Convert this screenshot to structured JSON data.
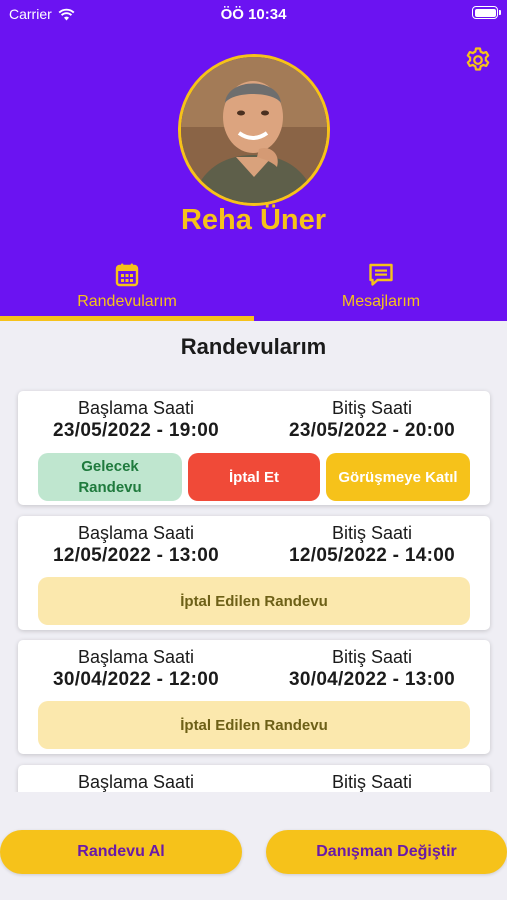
{
  "status_bar": {
    "carrier": "Carrier",
    "time": "ÖÖ 10:34"
  },
  "profile": {
    "name": "Reha Üner"
  },
  "tabs": [
    {
      "label": "Randevularım",
      "icon": "calendar-icon",
      "active": true
    },
    {
      "label": "Mesajlarım",
      "icon": "message-icon",
      "active": false
    }
  ],
  "section_title": "Randevularım",
  "appointments": [
    {
      "start_label": "Başlama Saati",
      "start": "23/05/2022 - 19:00",
      "end_label": "Bitiş Saati",
      "end": "23/05/2022 - 20:00",
      "status": "Gelecek Randevu",
      "cancel_label": "İptal Et",
      "join_label": "Görüşmeye Katıl"
    },
    {
      "start_label": "Başlama Saati",
      "start": "12/05/2022 - 13:00",
      "end_label": "Bitiş Saati",
      "end": "12/05/2022 - 14:00",
      "status": "İptal Edilen Randevu"
    },
    {
      "start_label": "Başlama Saati",
      "start": "30/04/2022 - 12:00",
      "end_label": "Bitiş Saati",
      "end": "30/04/2022 - 13:00",
      "status": "İptal Edilen Randevu"
    },
    {
      "start_label": "Başlama Saati",
      "end_label": "Bitiş Saati"
    }
  ],
  "actions": {
    "book": "Randevu Al",
    "change_consultant": "Danışman Değiştir"
  },
  "colors": {
    "header": "#6b13f2",
    "accent": "#f6c21a",
    "cancel": "#f04a38",
    "upcoming": "#bfe6cf",
    "cancelled": "#fbe8ad"
  }
}
